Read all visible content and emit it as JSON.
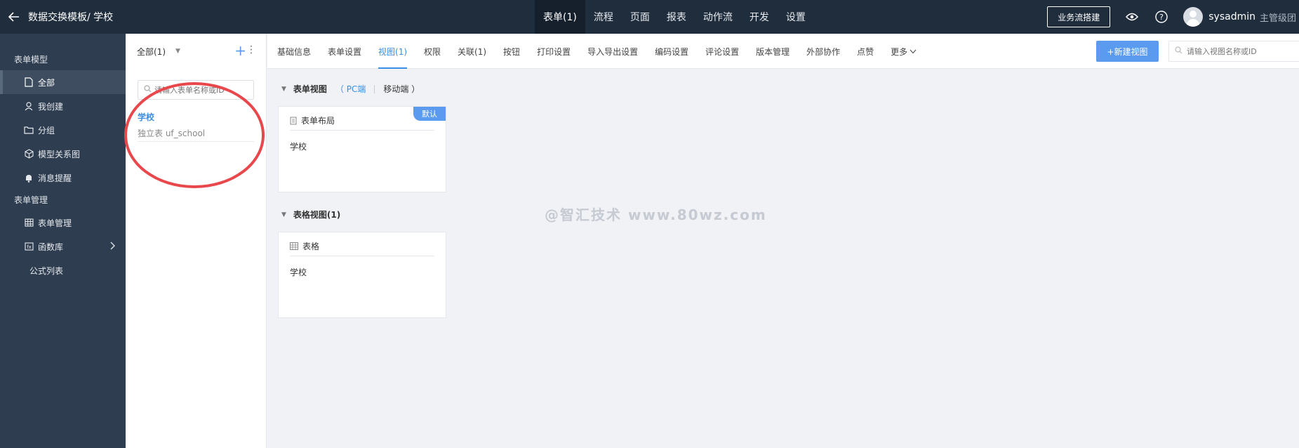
{
  "header": {
    "title": "数据交换模板/ 学校",
    "nav": [
      "表单(1)",
      "流程",
      "页面",
      "报表",
      "动作流",
      "开发",
      "设置"
    ],
    "active_nav_index": 0,
    "build_button": "业务流搭建",
    "username": "sysadmin",
    "role": "主管级团"
  },
  "sidebar": {
    "group1": "表单模型",
    "items1": [
      {
        "label": "全部",
        "icon": "file-icon",
        "active": true
      },
      {
        "label": "我创建",
        "icon": "user-icon"
      },
      {
        "label": "分组",
        "icon": "folder-icon"
      },
      {
        "label": "模型关系图",
        "icon": "cube-icon"
      },
      {
        "label": "消息提醒",
        "icon": "bell-icon"
      }
    ],
    "group2": "表单管理",
    "items2": [
      {
        "label": "表单管理",
        "icon": "table-icon"
      },
      {
        "label": "函数库",
        "icon": "function-icon"
      },
      {
        "label": "公式列表"
      }
    ]
  },
  "form_list": {
    "filter_label": "全部(1)",
    "search_placeholder": "请输入表单名称或ID",
    "items": [
      {
        "name": "学校",
        "subtitle": "独立表 uf_school"
      }
    ]
  },
  "tabs": [
    "基础信息",
    "表单设置",
    "视图(1)",
    "权限",
    "关联(1)",
    "按钮",
    "打印设置",
    "导入导出设置",
    "编码设置",
    "评论设置",
    "版本管理",
    "外部协作",
    "点赞",
    "更多"
  ],
  "active_tab_index": 2,
  "new_view_button": "+新建视图",
  "view_search_placeholder": "请输入视图名称或ID",
  "form_views": {
    "title": "表单视图",
    "pc_label": "（ PC端",
    "mobile_label": "移动端 ）",
    "card": {
      "title": "表单布局",
      "body": "学校",
      "badge": "默认"
    }
  },
  "grid_views": {
    "title": "表格视图(1)",
    "card": {
      "title": "表格",
      "body": "学校"
    }
  },
  "watermark": "@智汇技术 www.80wz.com"
}
